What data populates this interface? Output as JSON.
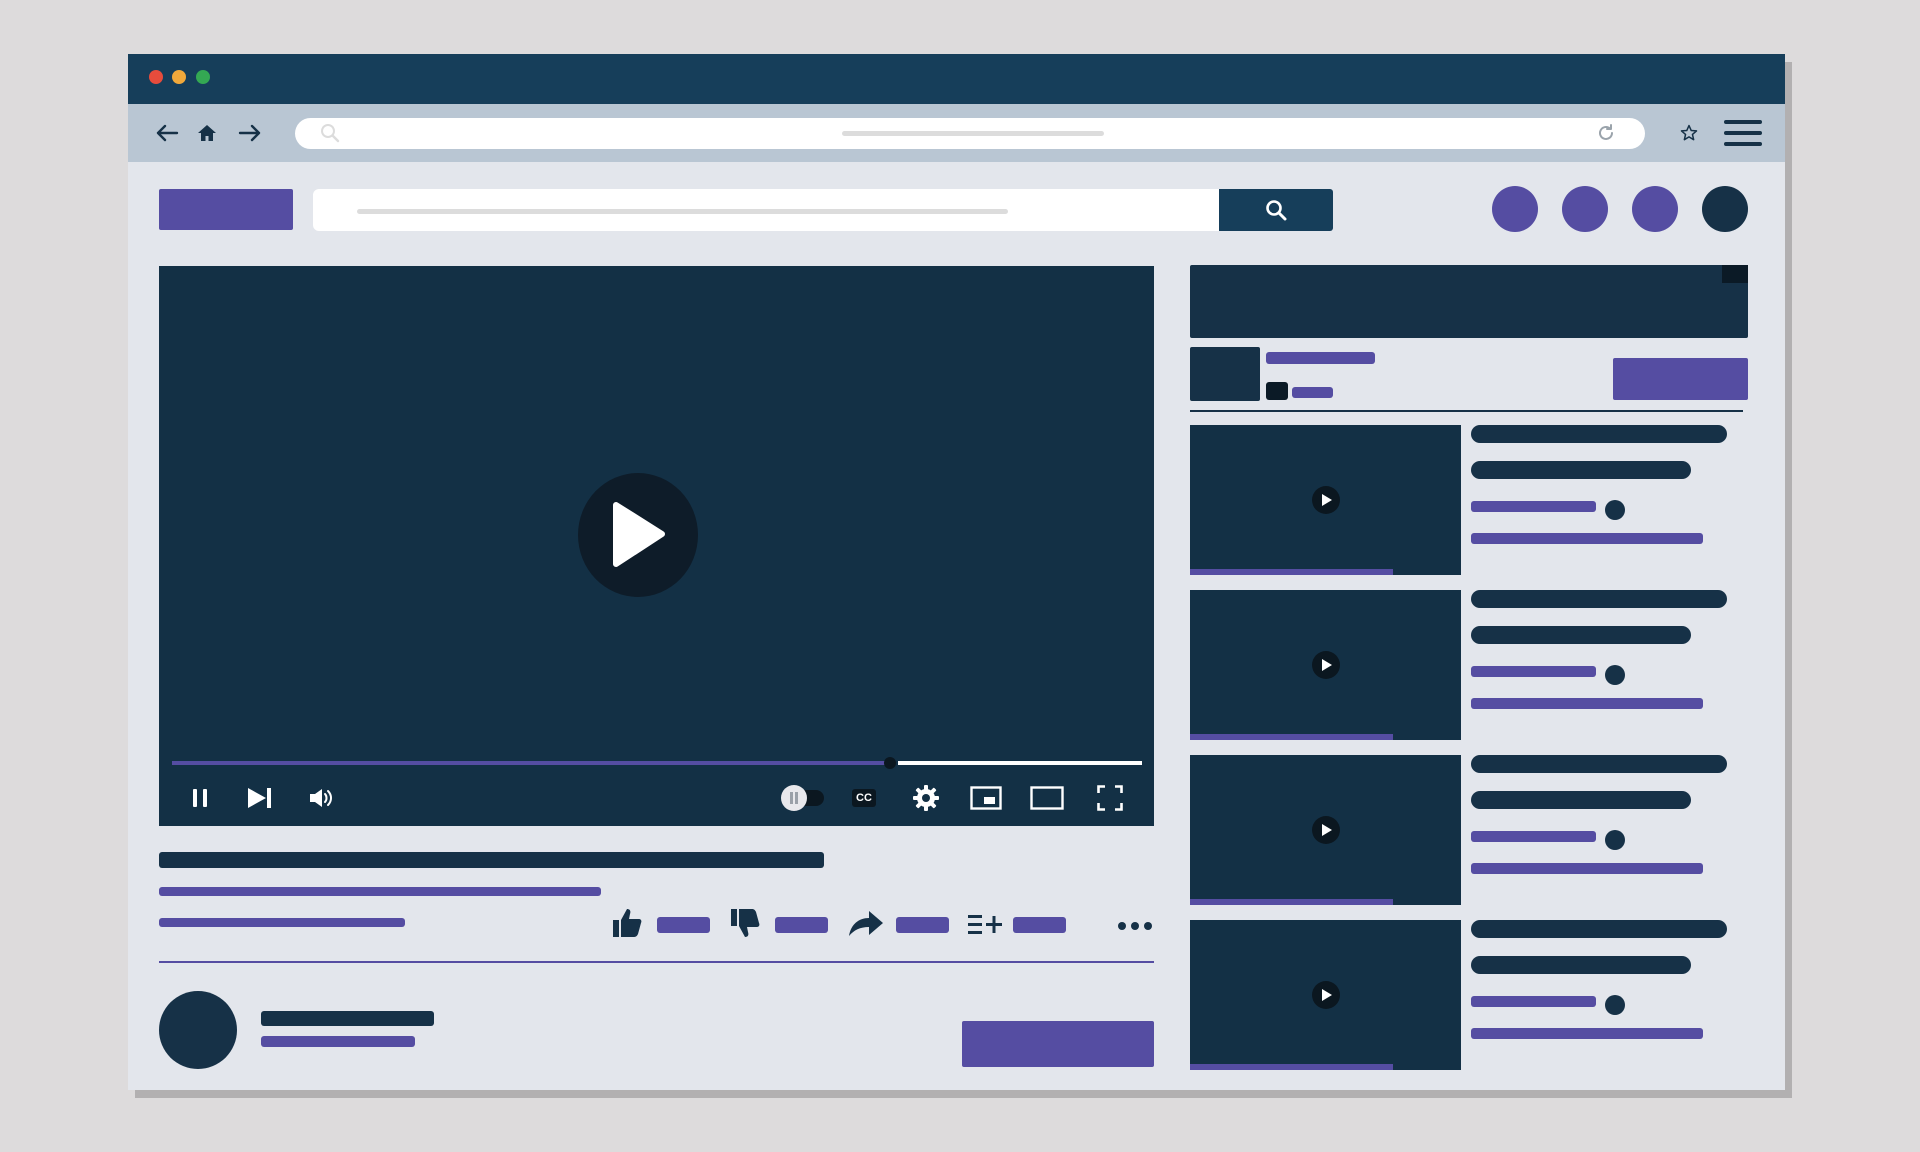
{
  "browser": {
    "traffic_lights": [
      "#e74c3c",
      "#f1a93b",
      "#34a853"
    ],
    "nav_icons": [
      "back-arrow-icon",
      "home-icon",
      "forward-arrow-icon"
    ],
    "right_icons": [
      "star-icon",
      "hamburger-menu-icon"
    ]
  },
  "site": {
    "header_icons": [
      "search-icon"
    ],
    "header_circle_colors": [
      "#554da2",
      "#554da2",
      "#554da2",
      "#163147"
    ]
  },
  "player": {
    "progress_fraction": 0.73,
    "controls": [
      "pause-icon",
      "skip-next-icon",
      "volume-icon",
      "autoplay-toggle",
      "cc-icon",
      "settings-gear-icon",
      "miniplayer-icon",
      "theater-mode-icon",
      "fullscreen-icon"
    ],
    "cc_label": "CC"
  },
  "actions": [
    "like-icon",
    "dislike-icon",
    "share-icon",
    "add-to-playlist-icon",
    "more-icon"
  ],
  "recommendations": {
    "count": 4,
    "watched_fraction": 0.75
  },
  "colors": {
    "accent": "#554da2",
    "dark": "#163147",
    "titlebar": "#163e5a",
    "page_bg": "#e3e6ec"
  }
}
